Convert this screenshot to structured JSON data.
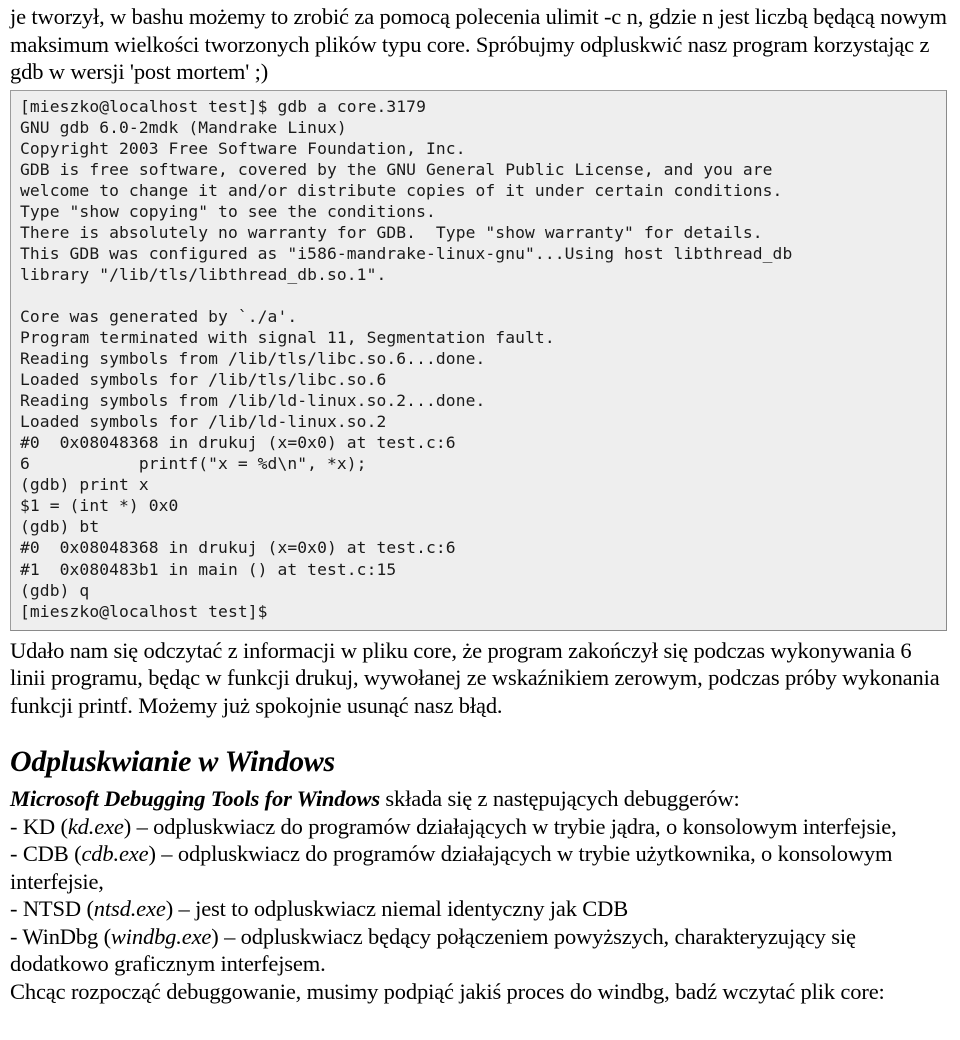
{
  "document": {
    "intro_paragraph": "je tworzył, w bashu możemy to zrobić za pomocą polecenia ulimit -c n, gdzie n jest liczbą będącą nowym maksimum wielkości tworzonych plików typu core. Spróbujmy odpluskwić nasz program korzystając z gdb w wersji 'post mortem' ;)",
    "terminal": {
      "lines": [
        "[mieszko@localhost test]$ gdb a core.3179",
        "GNU gdb 6.0-2mdk (Mandrake Linux)",
        "Copyright 2003 Free Software Foundation, Inc.",
        "GDB is free software, covered by the GNU General Public License, and you are",
        "welcome to change it and/or distribute copies of it under certain conditions.",
        "Type \"show copying\" to see the conditions.",
        "There is absolutely no warranty for GDB.  Type \"show warranty\" for details.",
        "This GDB was configured as \"i586-mandrake-linux-gnu\"...Using host libthread_db",
        "library \"/lib/tls/libthread_db.so.1\".",
        "",
        "Core was generated by `./a'.",
        "Program terminated with signal 11, Segmentation fault.",
        "Reading symbols from /lib/tls/libc.so.6...done.",
        "Loaded symbols for /lib/tls/libc.so.6",
        "Reading symbols from /lib/ld-linux.so.2...done.",
        "Loaded symbols for /lib/ld-linux.so.2",
        "#0  0x08048368 in drukuj (x=0x0) at test.c:6",
        "6           printf(\"x = %d\\n\", *x);",
        "(gdb) print x",
        "$1 = (int *) 0x0",
        "(gdb) bt",
        "#0  0x08048368 in drukuj (x=0x0) at test.c:6",
        "#1  0x080483b1 in main () at test.c:15",
        "(gdb) q",
        "[mieszko@localhost test]$"
      ]
    },
    "paragraph_after_terminal": "Udało nam się odczytać z informacji w pliku core, że program zakończył się podczas wykonywania 6 linii programu, będąc w funkcji drukuj, wywołanej ze wskaźnikiem zerowym, podczas próby wykonania funkcji printf. Możemy już spokojnie usunąć nasz błąd.",
    "section_heading": "Odpluskwianie w Windows",
    "tools_intro": {
      "strong": "Microsoft Debugging Tools for Windows",
      "rest": " składa się z następujących debuggerów:"
    },
    "debugger_list": [
      {
        "prefix": " - KD  (",
        "exe": "kd.exe",
        "suffix": ") – odpluskwiacz do programów działających w trybie jądra, o konsolowym interfejsie,"
      },
      {
        "prefix": " - CDB  (",
        "exe": "cdb.exe",
        "suffix": ") – odpluskwiacz do programów działających w trybie użytkownika, o konsolowym interfejsie,"
      },
      {
        "prefix": " - NTSD  (",
        "exe": "ntsd.exe",
        "suffix": ") – jest to odpluskwiacz niemal identyczny jak CDB"
      },
      {
        "prefix": " - WinDbg  (",
        "exe": "windbg.exe",
        "suffix": ") – odpluskwiacz będący połączeniem powyższych, charakteryzujący się dodatkowo graficznym interfejsem."
      }
    ],
    "closing_line": "Chcąc rozpocząć debuggowanie, musimy podpiąć jakiś proces do windbg, badź wczytać plik core:"
  },
  "colors": {
    "page_background": "#ffffff",
    "code_background": "#eeeeee",
    "code_border": "#9b9b9b",
    "text": "#000000"
  }
}
